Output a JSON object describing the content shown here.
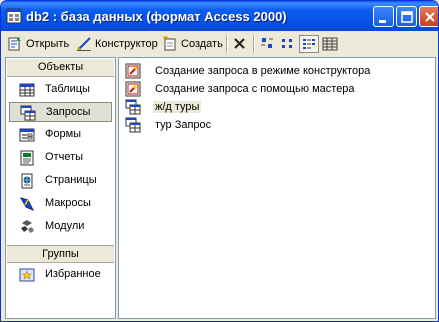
{
  "window": {
    "title": "db2 : база данных (формат Access 2000)"
  },
  "toolbar": {
    "open_label": "Открыть",
    "design_label": "Конструктор",
    "create_label": "Создать"
  },
  "objects_pane": {
    "objects_header": "Объекты",
    "items": [
      {
        "label": "Таблицы",
        "icon": "table-icon"
      },
      {
        "label": "Запросы",
        "icon": "query-icon",
        "selected": true
      },
      {
        "label": "Формы",
        "icon": "form-icon"
      },
      {
        "label": "Отчеты",
        "icon": "report-icon"
      },
      {
        "label": "Страницы",
        "icon": "page-icon"
      },
      {
        "label": "Макросы",
        "icon": "macro-icon"
      },
      {
        "label": "Модули",
        "icon": "module-icon"
      }
    ],
    "groups_header": "Группы",
    "groups": [
      {
        "label": "Избранное",
        "icon": "favorites-icon"
      }
    ]
  },
  "list": {
    "items": [
      {
        "label": "Создание запроса в режиме конструктора",
        "icon": "wizard-design-icon"
      },
      {
        "label": "Создание запроса с помощью мастера",
        "icon": "wizard-icon"
      },
      {
        "label": "ж/д туры",
        "icon": "query-icon"
      },
      {
        "label": "тур Запрос",
        "icon": "query-icon"
      }
    ]
  },
  "colors": {
    "titlebar": "#0553e3",
    "window_bg": "#ece9d8",
    "pane_border": "#7f9db9"
  }
}
